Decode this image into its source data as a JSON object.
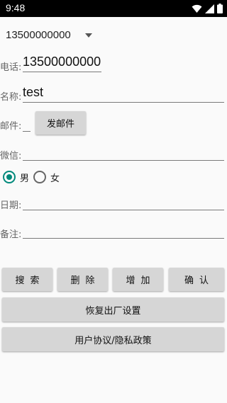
{
  "status_bar": {
    "time": "9:48"
  },
  "spinner": {
    "selected": "13500000000"
  },
  "form": {
    "phone_label": "电话:",
    "phone_value": "13500000000",
    "name_label": "名称:",
    "name_value": "test",
    "email_label": "邮件:",
    "email_value": "",
    "send_email_label": "发邮件",
    "wechat_label": "微信:",
    "wechat_value": "",
    "gender_male": "男",
    "gender_female": "女",
    "gender_selected": "男",
    "date_label": "日期:",
    "date_value": "",
    "note_label": "备注:",
    "note_value": ""
  },
  "actions": {
    "search": "搜索",
    "delete": "删除",
    "add": "增加",
    "confirm": "确认",
    "factory_reset": "恢复出厂设置",
    "agreement": "用户协议/隐私政策"
  },
  "colors": {
    "accent": "#00897b",
    "button_bg": "#d6d6d6",
    "status_bar": "#000000"
  }
}
